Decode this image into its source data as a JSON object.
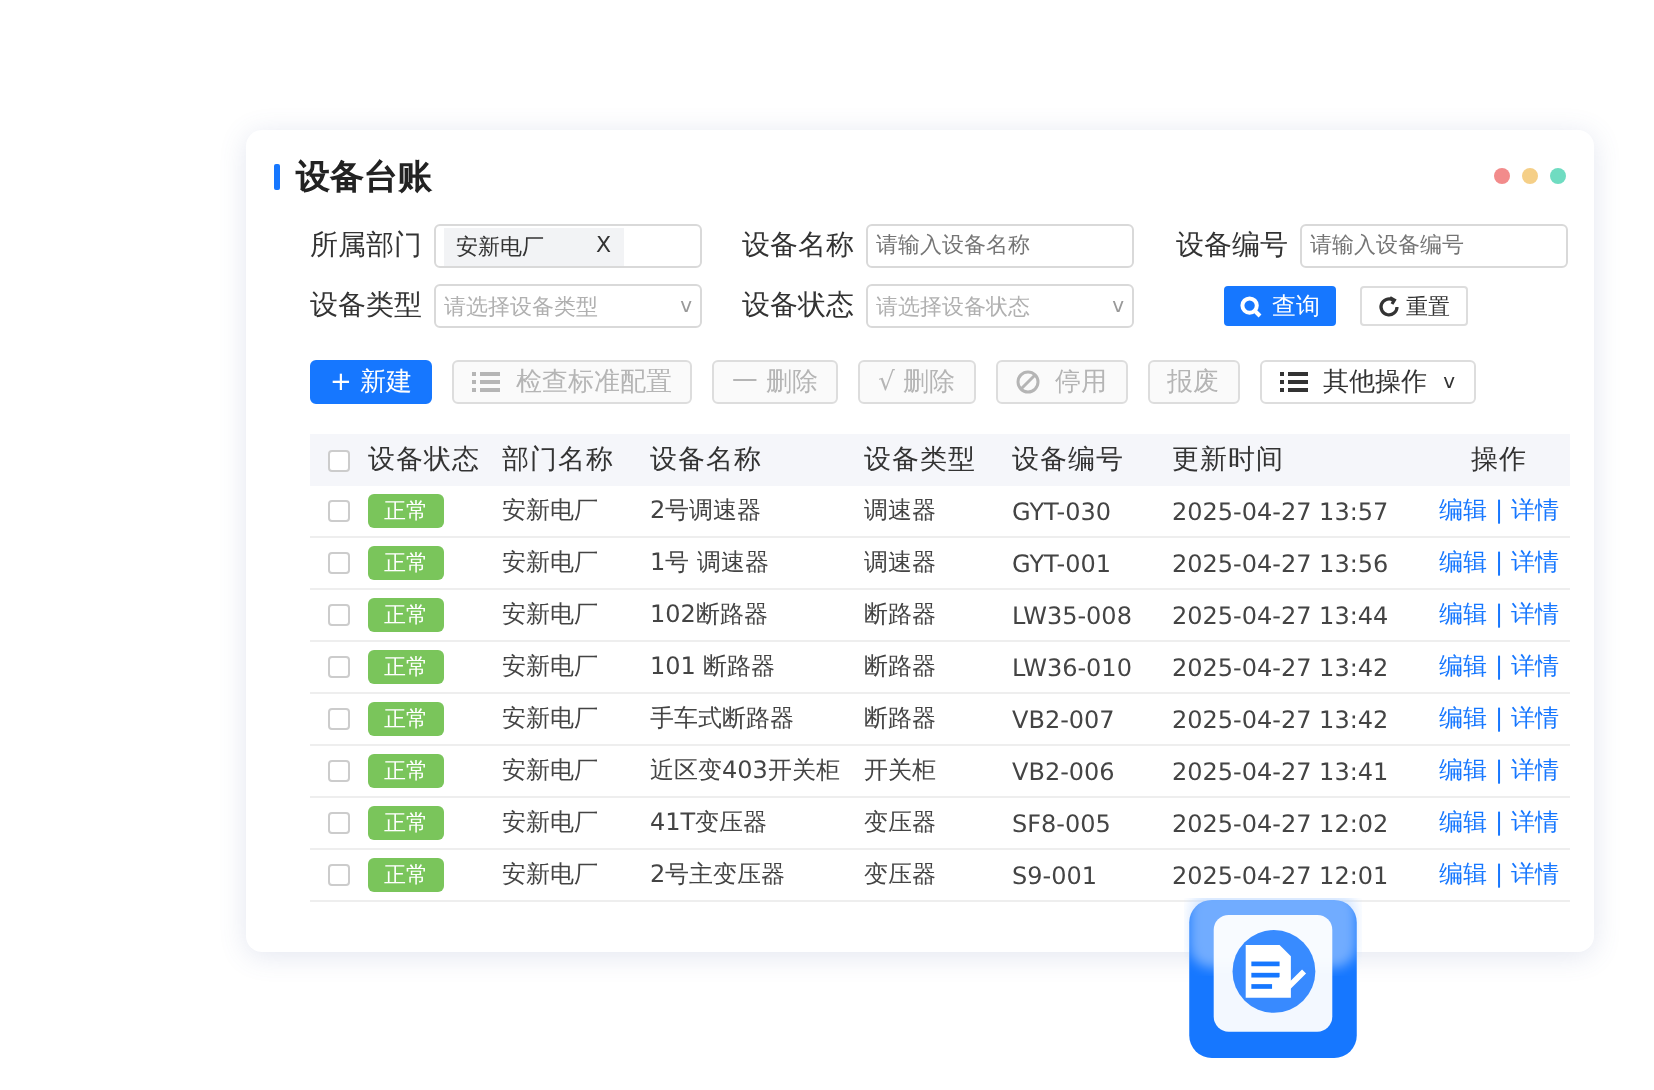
{
  "title": "设备台账",
  "filters": [
    {
      "label": "所属部门",
      "kind": "tag",
      "tag": "安新电厂",
      "clear": "X"
    },
    {
      "label": "设备名称",
      "kind": "input",
      "placeholder": "请输入设备名称"
    },
    {
      "label": "设备编号",
      "kind": "input",
      "placeholder": "请输入设备编号"
    },
    {
      "label": "设备类型",
      "kind": "select",
      "placeholder": "请选择设备类型",
      "caret": "v"
    },
    {
      "label": "设备状态",
      "kind": "select",
      "placeholder": "请选择设备状态",
      "caret": "v"
    }
  ],
  "search_button": "查询",
  "reset_button": "重置",
  "toolbar": [
    {
      "label": "+ 新建",
      "kind": "primary",
      "disabled": false
    },
    {
      "label": "检查标准配置",
      "kind": "list",
      "disabled": true
    },
    {
      "label": "一 删除",
      "kind": "plain",
      "disabled": true
    },
    {
      "label": "√  删除",
      "kind": "plain",
      "disabled": true
    },
    {
      "label": "停用",
      "kind": "ban",
      "disabled": true
    },
    {
      "label": "报废",
      "kind": "plain",
      "disabled": true
    },
    {
      "label": "其他操作",
      "kind": "menu",
      "disabled": false,
      "caret": "v"
    }
  ],
  "table": {
    "all_checked": false,
    "columns": [
      "设备状态",
      "部门名称",
      "设备名称",
      "设备类型",
      "设备编号",
      "更新时间",
      "操作"
    ],
    "rows": [
      {
        "checked": false,
        "status": "正常",
        "dept": "安新电厂",
        "name": "2号调速器",
        "type": "调速器",
        "code": "GYT-030",
        "time": "2025-04-27 13:57",
        "edit": "编辑",
        "sep": "|",
        "detail": "详情"
      },
      {
        "checked": false,
        "status": "正常",
        "dept": "安新电厂",
        "name": "1号 调速器",
        "type": "调速器",
        "code": "GYT-001",
        "time": "2025-04-27 13:56",
        "edit": "编辑",
        "sep": "|",
        "detail": "详情"
      },
      {
        "checked": false,
        "status": "正常",
        "dept": "安新电厂",
        "name": "102断路器",
        "type": "断路器",
        "code": "LW35-008",
        "time": "2025-04-27 13:44",
        "edit": "编辑",
        "sep": "|",
        "detail": "详情"
      },
      {
        "checked": false,
        "status": "正常",
        "dept": "安新电厂",
        "name": "101 断路器",
        "type": "断路器",
        "code": "LW36-010",
        "time": "2025-04-27 13:42",
        "edit": "编辑",
        "sep": "|",
        "detail": "详情"
      },
      {
        "checked": false,
        "status": "正常",
        "dept": "安新电厂",
        "name": "手车式断路器",
        "type": "断路器",
        "code": "VB2-007",
        "time": "2025-04-27 13:42",
        "edit": "编辑",
        "sep": "|",
        "detail": "详情"
      },
      {
        "checked": false,
        "status": "正常",
        "dept": "安新电厂",
        "name": "近区变403开关柜",
        "type": "开关柜",
        "code": "VB2-006",
        "time": "2025-04-27 13:41",
        "edit": "编辑",
        "sep": "|",
        "detail": "详情"
      },
      {
        "checked": false,
        "status": "正常",
        "dept": "安新电厂",
        "name": "41T变压器",
        "type": "变压器",
        "code": "SF8-005",
        "time": "2025-04-27 12:02",
        "edit": "编辑",
        "sep": "|",
        "detail": "详情"
      },
      {
        "checked": false,
        "status": "正常",
        "dept": "安新电厂",
        "name": "2号主变压器",
        "type": "变压器",
        "code": "S9-001",
        "time": "2025-04-27 12:01",
        "edit": "编辑",
        "sep": "|",
        "detail": "详情"
      }
    ]
  }
}
